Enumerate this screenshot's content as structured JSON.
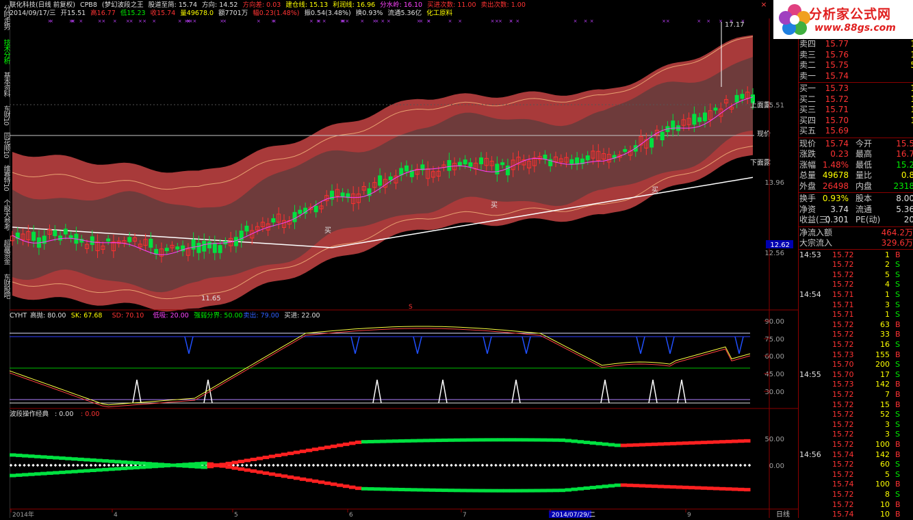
{
  "left_tabs": [
    {
      "label": "分时走势",
      "active": false
    },
    {
      "label": "技术分析",
      "active": true
    },
    {
      "label": "基本资料",
      "active": false
    },
    {
      "label": "东财10",
      "active": false
    },
    {
      "label": "同花顺10",
      "active": false
    },
    {
      "label": "维赛特10",
      "active": false
    },
    {
      "label": "个股大参考",
      "active": false
    },
    {
      "label": "超赢资金",
      "active": false
    },
    {
      "label": "东财股吧",
      "active": false
    }
  ],
  "header": {
    "line1": [
      {
        "text": "联化科技(日线 前复权)",
        "color": "white"
      },
      {
        "text": "CPB8",
        "color": "white"
      },
      {
        "text": "(梦幻波段之王",
        "color": "white"
      },
      {
        "text": "股道至简: 15.74",
        "color": "white"
      },
      {
        "text": "方向: 14.52",
        "color": "white"
      },
      {
        "text": "方向差: 0.03",
        "color": "red"
      },
      {
        "text": "建仓线: 15.13",
        "color": "yellow"
      },
      {
        "text": "利润线: 16.96",
        "color": "yellow"
      },
      {
        "text": "分水岭: 16.10",
        "color": "mag"
      },
      {
        "text": "买进次数: 11.00",
        "color": "red"
      },
      {
        "text": "卖出次数: 1.00",
        "color": "red"
      }
    ],
    "line2": [
      {
        "text": "2014/09/17/三",
        "color": "white"
      },
      {
        "text": "开15.51",
        "color": "white"
      },
      {
        "text": "高16.77",
        "color": "red"
      },
      {
        "text": "低15.23",
        "color": "green"
      },
      {
        "text": "收15.74",
        "color": "red"
      },
      {
        "text": "量49678.0",
        "color": "yellow"
      },
      {
        "text": "额7701万",
        "color": "white"
      },
      {
        "text": "幅0.23(1.48%)",
        "color": "red"
      },
      {
        "text": "振0.54(3.48%)",
        "color": "white"
      },
      {
        "text": "换0.93%",
        "color": "white"
      },
      {
        "text": "流通5.36亿",
        "color": "white"
      },
      {
        "text": "化工原料",
        "color": "yellow"
      }
    ]
  },
  "logo": {
    "title": "分析家公式网",
    "url": "www.88gs.com"
  },
  "main_chart": {
    "price_labels": [
      "15.51",
      "13.96",
      "12.62",
      "12.56"
    ],
    "annotations": {
      "high": "17.17",
      "low": "11.65",
      "upper": "上面露",
      "current": "现价",
      "lower": "下面露",
      "buy": "买",
      "buy2": "买",
      "buy3": "买",
      "s_mark": "S"
    }
  },
  "indicator1": {
    "title": "CYHT",
    "legend": [
      {
        "text": "高抛: 80.00",
        "color": "white"
      },
      {
        "text": "SK: 67.68",
        "color": "yellow"
      },
      {
        "text": "SD: 70.10",
        "color": "red"
      },
      {
        "text": "低吸: 20.00",
        "color": "mag"
      },
      {
        "text": "强弱分界: 50.00",
        "color": "green"
      },
      {
        "text": "卖出: 79.00",
        "color": "blue"
      },
      {
        "text": "买进: 22.00",
        "color": "white"
      }
    ],
    "yticks": [
      "90.00",
      "75.00",
      "60.00",
      "45.00",
      "30.00"
    ]
  },
  "indicator2": {
    "title": "波段操作经典",
    "legend": [
      {
        "text": ": 0.00",
        "color": "white"
      },
      {
        "text": ": 0.00",
        "color": "red"
      }
    ],
    "yticks": [
      "50.00",
      "0.00"
    ]
  },
  "xaxis": {
    "labels": [
      "2014年",
      "4",
      "5",
      "6",
      "7",
      "2014/07/29/二",
      "9"
    ],
    "period": "日线"
  },
  "quote": {
    "asks": [
      {
        "label": "卖四",
        "price": "15.77",
        "vol": "1"
      },
      {
        "label": "卖三",
        "price": "15.76",
        "vol": "1"
      },
      {
        "label": "卖二",
        "price": "15.75",
        "vol": "5"
      },
      {
        "label": "卖一",
        "price": "15.74",
        "vol": ""
      }
    ],
    "bids": [
      {
        "label": "买一",
        "price": "15.73",
        "vol": "1"
      },
      {
        "label": "买二",
        "price": "15.72",
        "vol": "1"
      },
      {
        "label": "买三",
        "price": "15.71",
        "vol": "1"
      },
      {
        "label": "买四",
        "price": "15.70",
        "vol": "1"
      },
      {
        "label": "买五",
        "price": "15.69",
        "vol": ""
      }
    ],
    "stats": [
      {
        "l1": "现价",
        "v1": "15.74",
        "c1": "red",
        "l2": "今开",
        "v2": "15.5",
        "c2": "red"
      },
      {
        "l1": "涨跌",
        "v1": "0.23",
        "c1": "red",
        "l2": "最高",
        "v2": "16.7",
        "c2": "red"
      },
      {
        "l1": "涨幅",
        "v1": "1.48%",
        "c1": "red",
        "l2": "最低",
        "v2": "15.2",
        "c2": "green"
      },
      {
        "l1": "总量",
        "v1": "49678",
        "c1": "yellow",
        "l2": "量比",
        "v2": "0.8",
        "c2": "yellow"
      },
      {
        "l1": "外盘",
        "v1": "26498",
        "c1": "red",
        "l2": "内盘",
        "v2": "2318",
        "c2": "green"
      },
      {
        "l1": "换手",
        "v1": "0.93%",
        "c1": "yellow",
        "l2": "股本",
        "v2": "8.00",
        "c2": "white"
      },
      {
        "l1": "净资",
        "v1": "3.74",
        "c1": "white",
        "l2": "流通",
        "v2": "5.36",
        "c2": "white"
      },
      {
        "l1": "收益(三)",
        "v1": "0.301",
        "c1": "white",
        "l2": "PE(动)",
        "v2": "20",
        "c2": "white"
      }
    ],
    "flows": [
      {
        "label": "净流入额",
        "value": "464.2万"
      },
      {
        "label": "大宗流入",
        "value": "329.6万"
      }
    ],
    "ticks": [
      {
        "t": "14:53",
        "p": "15.72",
        "v": "1",
        "d": "B"
      },
      {
        "t": "",
        "p": "15.72",
        "v": "2",
        "d": "S"
      },
      {
        "t": "",
        "p": "15.72",
        "v": "5",
        "d": "S"
      },
      {
        "t": "",
        "p": "15.72",
        "v": "4",
        "d": "S"
      },
      {
        "t": "14:54",
        "p": "15.71",
        "v": "1",
        "d": "S"
      },
      {
        "t": "",
        "p": "15.71",
        "v": "3",
        "d": "S"
      },
      {
        "t": "",
        "p": "15.71",
        "v": "1",
        "d": "S"
      },
      {
        "t": "",
        "p": "15.72",
        "v": "63",
        "d": "B"
      },
      {
        "t": "",
        "p": "15.72",
        "v": "33",
        "d": "B"
      },
      {
        "t": "",
        "p": "15.72",
        "v": "16",
        "d": "S"
      },
      {
        "t": "",
        "p": "15.73",
        "v": "155",
        "d": "B"
      },
      {
        "t": "",
        "p": "15.70",
        "v": "200",
        "d": "S"
      },
      {
        "t": "14:55",
        "p": "15.70",
        "v": "17",
        "d": "S"
      },
      {
        "t": "",
        "p": "15.73",
        "v": "142",
        "d": "B"
      },
      {
        "t": "",
        "p": "15.72",
        "v": "7",
        "d": "B"
      },
      {
        "t": "",
        "p": "15.72",
        "v": "15",
        "d": "B"
      },
      {
        "t": "",
        "p": "15.72",
        "v": "52",
        "d": "S"
      },
      {
        "t": "",
        "p": "15.72",
        "v": "3",
        "d": "S"
      },
      {
        "t": "",
        "p": "15.72",
        "v": "3",
        "d": "S"
      },
      {
        "t": "",
        "p": "15.72",
        "v": "100",
        "d": "B"
      },
      {
        "t": "14:56",
        "p": "15.74",
        "v": "142",
        "d": "B"
      },
      {
        "t": "",
        "p": "15.72",
        "v": "60",
        "d": "S"
      },
      {
        "t": "",
        "p": "15.72",
        "v": "5",
        "d": "S"
      },
      {
        "t": "",
        "p": "15.74",
        "v": "100",
        "d": "B"
      },
      {
        "t": "",
        "p": "15.72",
        "v": "8",
        "d": "S"
      },
      {
        "t": "",
        "p": "15.72",
        "v": "10",
        "d": "B"
      },
      {
        "t": "",
        "p": "15.74",
        "v": "10",
        "d": "B"
      }
    ]
  }
}
